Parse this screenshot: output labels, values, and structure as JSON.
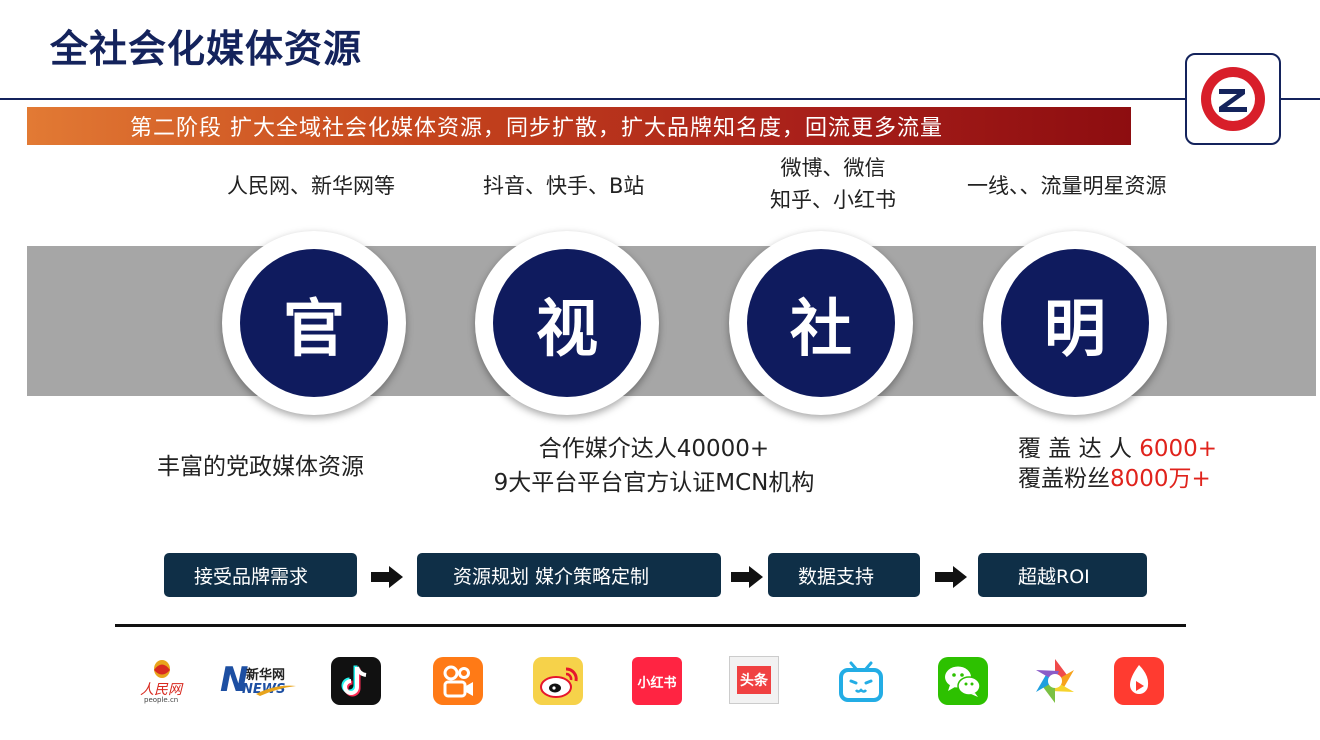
{
  "title": "全社会化媒体资源",
  "banner": "第二阶段 扩大全域社会化媒体资源，同步扩散，扩大品牌知名度，回流更多流量",
  "channels": [
    {
      "label": "人民网、新华网等",
      "char": "官",
      "desc": [
        "丰富的党政媒体资源"
      ]
    },
    {
      "label": "抖音、快手、B站",
      "char": "视",
      "desc": [
        "合作媒介达人40000+",
        "9大平台平台官方认证MCN机构"
      ]
    },
    {
      "label_lines": [
        "微博、微信",
        "知乎、小红书"
      ],
      "char": "社"
    },
    {
      "label": "一线、、流量明星资源",
      "char": "明",
      "desc_rows": [
        {
          "prefix": "覆 盖 达 人 ",
          "value": "6000+"
        },
        {
          "prefix": "覆盖粉丝",
          "value": "8000万+"
        }
      ]
    }
  ],
  "process": [
    "接受品牌需求",
    "资源规划 媒介策略定制",
    "数据支持",
    "超越ROI"
  ],
  "platforms": {
    "people_text": "人民网",
    "people_sub": "people.cn",
    "xinhua_text": "新华网",
    "xinhua_news": "NEWS",
    "xhs_text": "小红书",
    "toutiao_text": "头条"
  },
  "colors": {
    "navy": "#0f1b5e",
    "title": "#14235c",
    "step_bg": "#0f2f47",
    "highlight_red": "#e0231c",
    "band_gray": "#a6a6a6"
  }
}
